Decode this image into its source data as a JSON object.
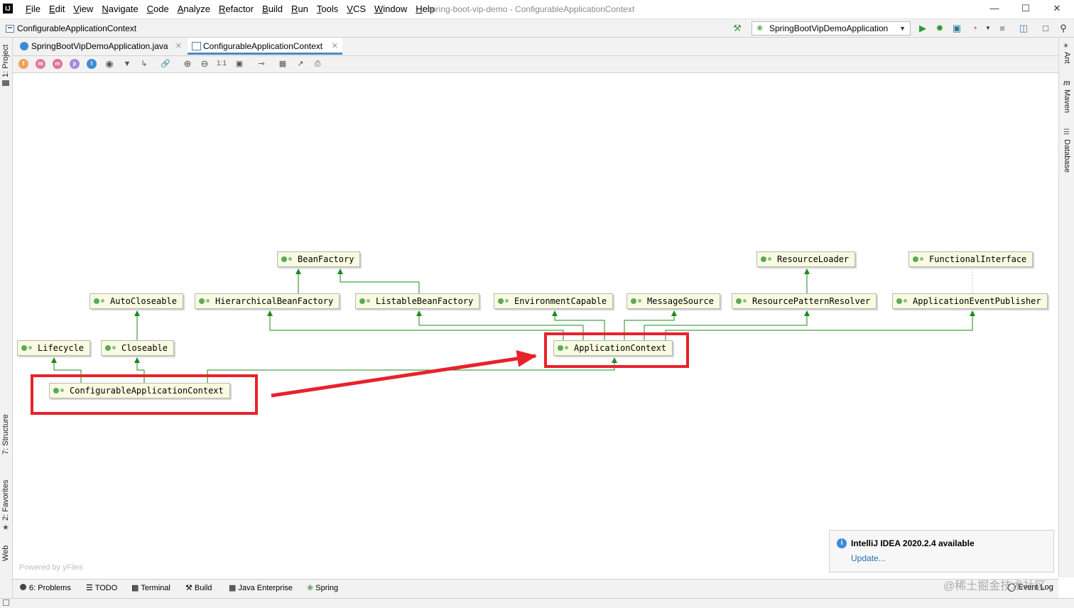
{
  "menu": {
    "items": [
      "File",
      "Edit",
      "View",
      "Navigate",
      "Code",
      "Analyze",
      "Refactor",
      "Build",
      "Run",
      "Tools",
      "VCS",
      "Window",
      "Help"
    ],
    "window_title": "spring-boot-vip-demo - ConfigurableApplicationContext"
  },
  "navbar": {
    "breadcrumb": "ConfigurableApplicationContext",
    "run_config": "SpringBootVipDemoApplication"
  },
  "tabs": [
    {
      "label": "SpringBootVipDemoApplication.java",
      "active": false
    },
    {
      "label": "ConfigurableApplicationContext",
      "active": true
    }
  ],
  "diagram_toolbar": {
    "scope_icons": [
      "f",
      "m",
      "m",
      "p",
      "I"
    ],
    "actual_size": "1:1"
  },
  "left_strip": {
    "project": "1: Project",
    "structure": "7: Structure",
    "favorites": "2: Favorites",
    "web": "Web"
  },
  "right_strip": {
    "ant": "Ant",
    "maven": "Maven",
    "database": "Database"
  },
  "diagram": {
    "nodes": {
      "bean_factory": "BeanFactory",
      "resource_loader": "ResourceLoader",
      "functional_interface": "FunctionalInterface",
      "auto_closeable": "AutoCloseable",
      "hierarchical_bean_factory": "HierarchicalBeanFactory",
      "listable_bean_factory": "ListableBeanFactory",
      "environment_capable": "EnvironmentCapable",
      "message_source": "MessageSource",
      "resource_pattern_resolver": "ResourcePatternResolver",
      "application_event_publisher": "ApplicationEventPublisher",
      "lifecycle": "Lifecycle",
      "closeable": "Closeable",
      "application_context": "ApplicationContext",
      "configurable_application_context": "ConfigurableApplicationContext"
    },
    "powered_by": "Powered by yFiles",
    "edge_color": "#1e8a1e",
    "highlight_color": "#e8222b"
  },
  "notification": {
    "title": "IntelliJ IDEA 2020.2.4 available",
    "link": "Update..."
  },
  "bottom_tools": {
    "problems": "6: Problems",
    "todo": "TODO",
    "terminal": "Terminal",
    "build": "Build",
    "java_enterprise": "Java Enterprise",
    "spring": "Spring",
    "event_log": "Event Log"
  },
  "watermark": "@稀土掘金技术社区"
}
